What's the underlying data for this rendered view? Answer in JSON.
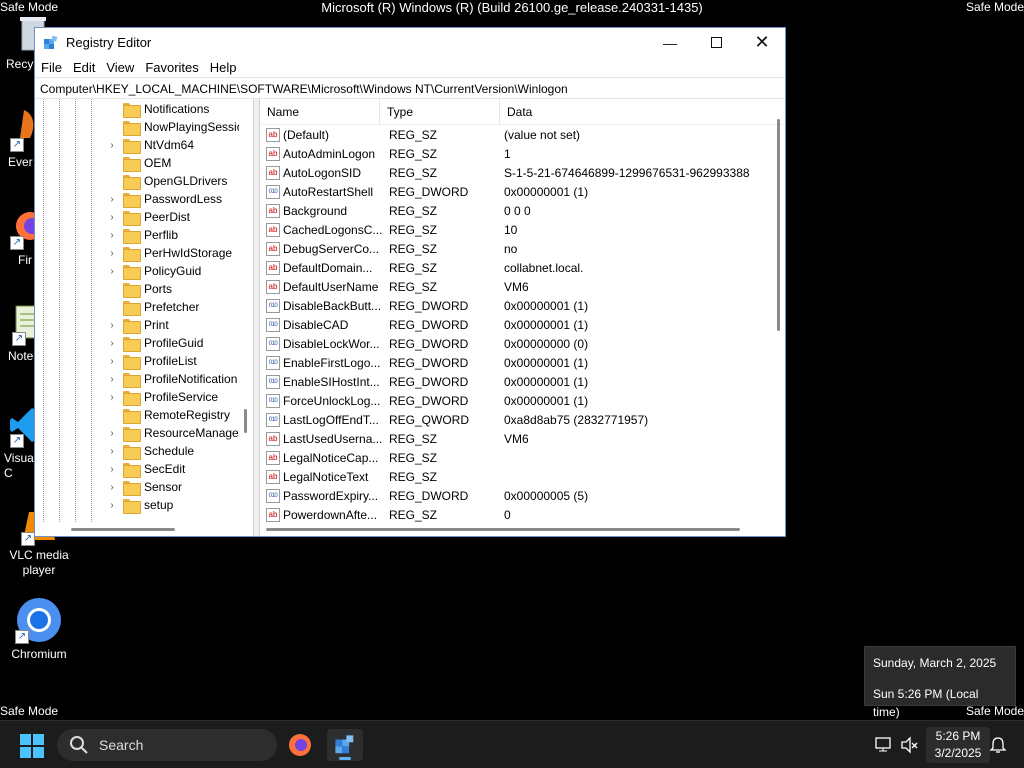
{
  "desktop": {
    "safe_mode_label": "Safe Mode",
    "build_text": "Microsoft (R) Windows (R) (Build 26100.ge_release.240331-1435)",
    "icons": [
      {
        "label": "Recy",
        "icon": "recycle-bin-icon"
      },
      {
        "label": "Ever",
        "icon": "app-shortcut-icon"
      },
      {
        "label": "Fir",
        "icon": "firefox-icon"
      },
      {
        "label": "Note",
        "icon": "notepad-icon"
      },
      {
        "label": "Visua\nC",
        "icon": "vscode-icon"
      },
      {
        "label": "VLC media player",
        "icon": "vlc-icon"
      },
      {
        "label": "Chromium",
        "icon": "chromium-icon"
      }
    ]
  },
  "window": {
    "title": "Registry Editor",
    "menu": [
      "File",
      "Edit",
      "View",
      "Favorites",
      "Help"
    ],
    "address": "Computer\\HKEY_LOCAL_MACHINE\\SOFTWARE\\Microsoft\\Windows NT\\CurrentVersion\\Winlogon",
    "tree": [
      {
        "label": "Notifications",
        "expandable": false
      },
      {
        "label": "NowPlayingSessio",
        "expandable": false
      },
      {
        "label": "NtVdm64",
        "expandable": true
      },
      {
        "label": "OEM",
        "expandable": false
      },
      {
        "label": "OpenGLDrivers",
        "expandable": false
      },
      {
        "label": "PasswordLess",
        "expandable": true
      },
      {
        "label": "PeerDist",
        "expandable": true
      },
      {
        "label": "Perflib",
        "expandable": true
      },
      {
        "label": "PerHwIdStorage",
        "expandable": true
      },
      {
        "label": "PolicyGuid",
        "expandable": true
      },
      {
        "label": "Ports",
        "expandable": false
      },
      {
        "label": "Prefetcher",
        "expandable": false
      },
      {
        "label": "Print",
        "expandable": true
      },
      {
        "label": "ProfileGuid",
        "expandable": true
      },
      {
        "label": "ProfileList",
        "expandable": true
      },
      {
        "label": "ProfileNotification",
        "expandable": true
      },
      {
        "label": "ProfileService",
        "expandable": true
      },
      {
        "label": "RemoteRegistry",
        "expandable": false
      },
      {
        "label": "ResourceManage",
        "expandable": true
      },
      {
        "label": "Schedule",
        "expandable": true
      },
      {
        "label": "SecEdit",
        "expandable": true
      },
      {
        "label": "Sensor",
        "expandable": true
      },
      {
        "label": "setup",
        "expandable": true
      }
    ],
    "columns": {
      "name": "Name",
      "type": "Type",
      "data": "Data"
    },
    "values": [
      {
        "name": "(Default)",
        "type": "REG_SZ",
        "data": "(value not set)",
        "kind": "string"
      },
      {
        "name": "AutoAdminLogon",
        "type": "REG_SZ",
        "data": "1",
        "kind": "string"
      },
      {
        "name": "AutoLogonSID",
        "type": "REG_SZ",
        "data": "S-1-5-21-674646899-1299676531-962993388",
        "kind": "string"
      },
      {
        "name": "AutoRestartShell",
        "type": "REG_DWORD",
        "data": "0x00000001 (1)",
        "kind": "binary"
      },
      {
        "name": "Background",
        "type": "REG_SZ",
        "data": "0 0 0",
        "kind": "string"
      },
      {
        "name": "CachedLogonsC...",
        "type": "REG_SZ",
        "data": "10",
        "kind": "string"
      },
      {
        "name": "DebugServerCo...",
        "type": "REG_SZ",
        "data": "no",
        "kind": "string"
      },
      {
        "name": "DefaultDomain...",
        "type": "REG_SZ",
        "data": "collabnet.local.",
        "kind": "string"
      },
      {
        "name": "DefaultUserName",
        "type": "REG_SZ",
        "data": "VM6",
        "kind": "string"
      },
      {
        "name": "DisableBackButt...",
        "type": "REG_DWORD",
        "data": "0x00000001 (1)",
        "kind": "binary"
      },
      {
        "name": "DisableCAD",
        "type": "REG_DWORD",
        "data": "0x00000001 (1)",
        "kind": "binary"
      },
      {
        "name": "DisableLockWor...",
        "type": "REG_DWORD",
        "data": "0x00000000 (0)",
        "kind": "binary"
      },
      {
        "name": "EnableFirstLogo...",
        "type": "REG_DWORD",
        "data": "0x00000001 (1)",
        "kind": "binary"
      },
      {
        "name": "EnableSIHostInt...",
        "type": "REG_DWORD",
        "data": "0x00000001 (1)",
        "kind": "binary"
      },
      {
        "name": "ForceUnlockLog...",
        "type": "REG_DWORD",
        "data": "0x00000001 (1)",
        "kind": "binary"
      },
      {
        "name": "LastLogOffEndT...",
        "type": "REG_QWORD",
        "data": "0xa8d8ab75 (2832771957)",
        "kind": "binary"
      },
      {
        "name": "LastUsedUserna...",
        "type": "REG_SZ",
        "data": "VM6",
        "kind": "string"
      },
      {
        "name": "LegalNoticeCap...",
        "type": "REG_SZ",
        "data": "",
        "kind": "string"
      },
      {
        "name": "LegalNoticeText",
        "type": "REG_SZ",
        "data": "",
        "kind": "string"
      },
      {
        "name": "PasswordExpiry...",
        "type": "REG_DWORD",
        "data": "0x00000005 (5)",
        "kind": "binary"
      },
      {
        "name": "PowerdownAfte...",
        "type": "REG_SZ",
        "data": "0",
        "kind": "string"
      }
    ]
  },
  "tooltip": {
    "date": "Sunday, March 2, 2025",
    "time": "Sun 5:26 PM (Local time)"
  },
  "taskbar": {
    "search_label": "Search",
    "clock_time": "5:26 PM",
    "clock_date": "3/2/2025"
  },
  "colors": {
    "accent": "#5fb2f2",
    "folder": "#f6cc55",
    "taskbar": "#1c1c1c"
  }
}
